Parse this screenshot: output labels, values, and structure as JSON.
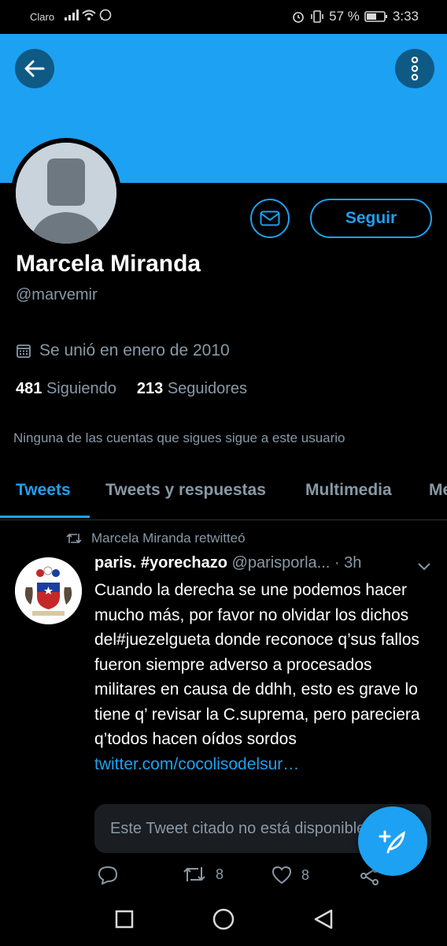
{
  "status_bar": {
    "carrier": "Claro",
    "battery": "57 %",
    "time": "3:33"
  },
  "header": {
    "back_icon": "arrow-left-icon",
    "more_icon": "vertical-dots-icon"
  },
  "profile": {
    "name": "Marcela Miranda",
    "handle": "@marvemir",
    "joined": "Se unió en enero de 2010",
    "following_count": "481",
    "following_label": "Siguiendo",
    "followers_count": "213",
    "followers_label": "Seguidores",
    "mutuals_note": "Ninguna de las cuentas que sigues sigue a este usuario",
    "follow_label": "Seguir"
  },
  "tabs": [
    {
      "label": "Tweets"
    },
    {
      "label": "Tweets y respuestas"
    },
    {
      "label": "Multimedia"
    },
    {
      "label": "Me"
    }
  ],
  "tweet": {
    "retweet_note": "Marcela Miranda retwitteó",
    "display_name": "paris. #yorechazo",
    "username": "@parisporla...",
    "time": "· 3h",
    "text": "Cuando la derecha se une podemos hacer mucho más, por favor no olvidar los dichos del#juezelgueta donde reconoce q’sus fallos fueron siempre adverso a procesados militares en causa de ddhh, esto es grave lo tiene q’ revisar la C.suprema, pero pareciera q’todos hacen oídos sordos",
    "link": "twitter.com/cocolisodelsur…",
    "quote_unavailable": "Este Tweet citado no está disponible.",
    "retweets": "8",
    "likes": "8"
  },
  "colors": {
    "accent": "#1da1f2",
    "background": "#000000",
    "secondary_text": "#8899a6"
  }
}
